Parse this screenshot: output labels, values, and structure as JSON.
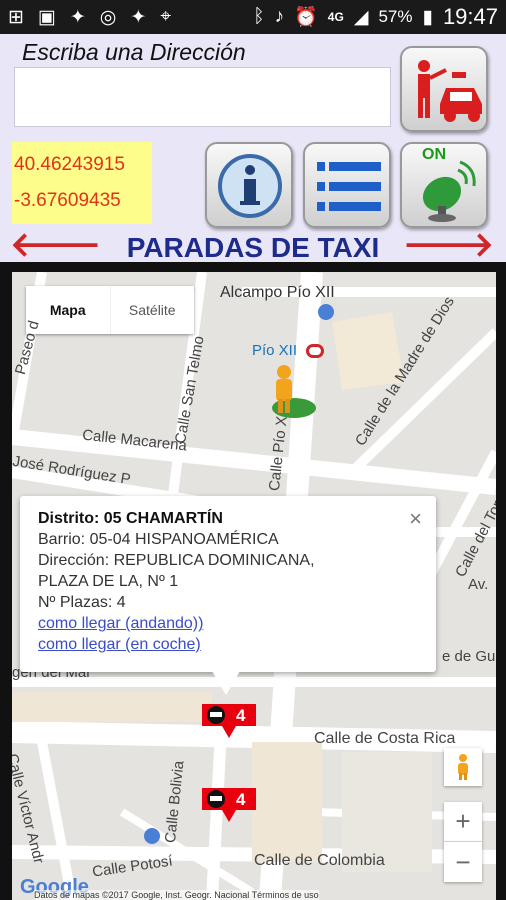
{
  "status_bar": {
    "time": "19:47",
    "battery": "57%",
    "network": "4G",
    "icons_left": [
      "add-box-icon",
      "image-icon",
      "twitter-icon",
      "instagram-icon",
      "twitter-icon",
      "location-icon"
    ],
    "icons_right": [
      "bluetooth-icon",
      "mute-icon",
      "alarm-icon",
      "signal-icon",
      "battery-icon"
    ]
  },
  "header": {
    "address_label": "Escriba una Dirección",
    "address_value": "",
    "latitude": "40.46243915",
    "longitude": "-3.67609435",
    "gps_state": "ON",
    "title": "PARADAS DE TAXI"
  },
  "map": {
    "type_buttons": [
      "Mapa",
      "Satélite"
    ],
    "selected_type": "Mapa",
    "labels": {
      "alcampo": "Alcampo Pío XII",
      "pio_xii_metro": "Pío XII",
      "paseo": "Paseo d",
      "calle_san_telmo": "Calle San Telmo",
      "calle_madre": "Calle de la Madre de Dios",
      "calle_macarena": "Calle Macarena",
      "jose_rodriguez": "José Rodríguez P",
      "calle_pio_xii": "Calle Pío XII",
      "calle_del_tom": "Calle del Tom",
      "av": "Av.",
      "de_gu": "e de Gu",
      "mar": "gen del Mar",
      "calle_costa_rica": "Calle de Costa Rica",
      "calle_bolivia": "Calle Bolivia",
      "calle_victor": "Calle Víctor Andr",
      "calle_potosi": "Calle Potosí",
      "calle_colombia": "Calle de Colombia"
    },
    "popup": {
      "district": "Distrito: 05  CHAMARTÍN",
      "barrio": "Barrio: 05-04 HISPANOAMÉRICA",
      "direccion_1": "Dirección: REPUBLICA DOMINICANA,",
      "direccion_2": "PLAZA DE LA, Nº 1",
      "plazas": "Nº Plazas: 4",
      "link_walk": "como llegar (andando))",
      "link_car": "como llegar (en coche)",
      "close": "×"
    },
    "stops": [
      {
        "count": "4"
      },
      {
        "count": "4"
      }
    ],
    "zoom_in": "+",
    "zoom_out": "−",
    "google_logo": "Google",
    "attribution": "Datos de mapas ©2017 Google, Inst. Geogr. Nacional    Términos de uso"
  },
  "colors": {
    "header_bg": "#e8e6f7",
    "title": "#1d2b8b",
    "arrows": "#d0262a",
    "coords_bg": "#fdfd8c",
    "coords_text": "#e0341a",
    "stop_marker": "#e8000f"
  }
}
